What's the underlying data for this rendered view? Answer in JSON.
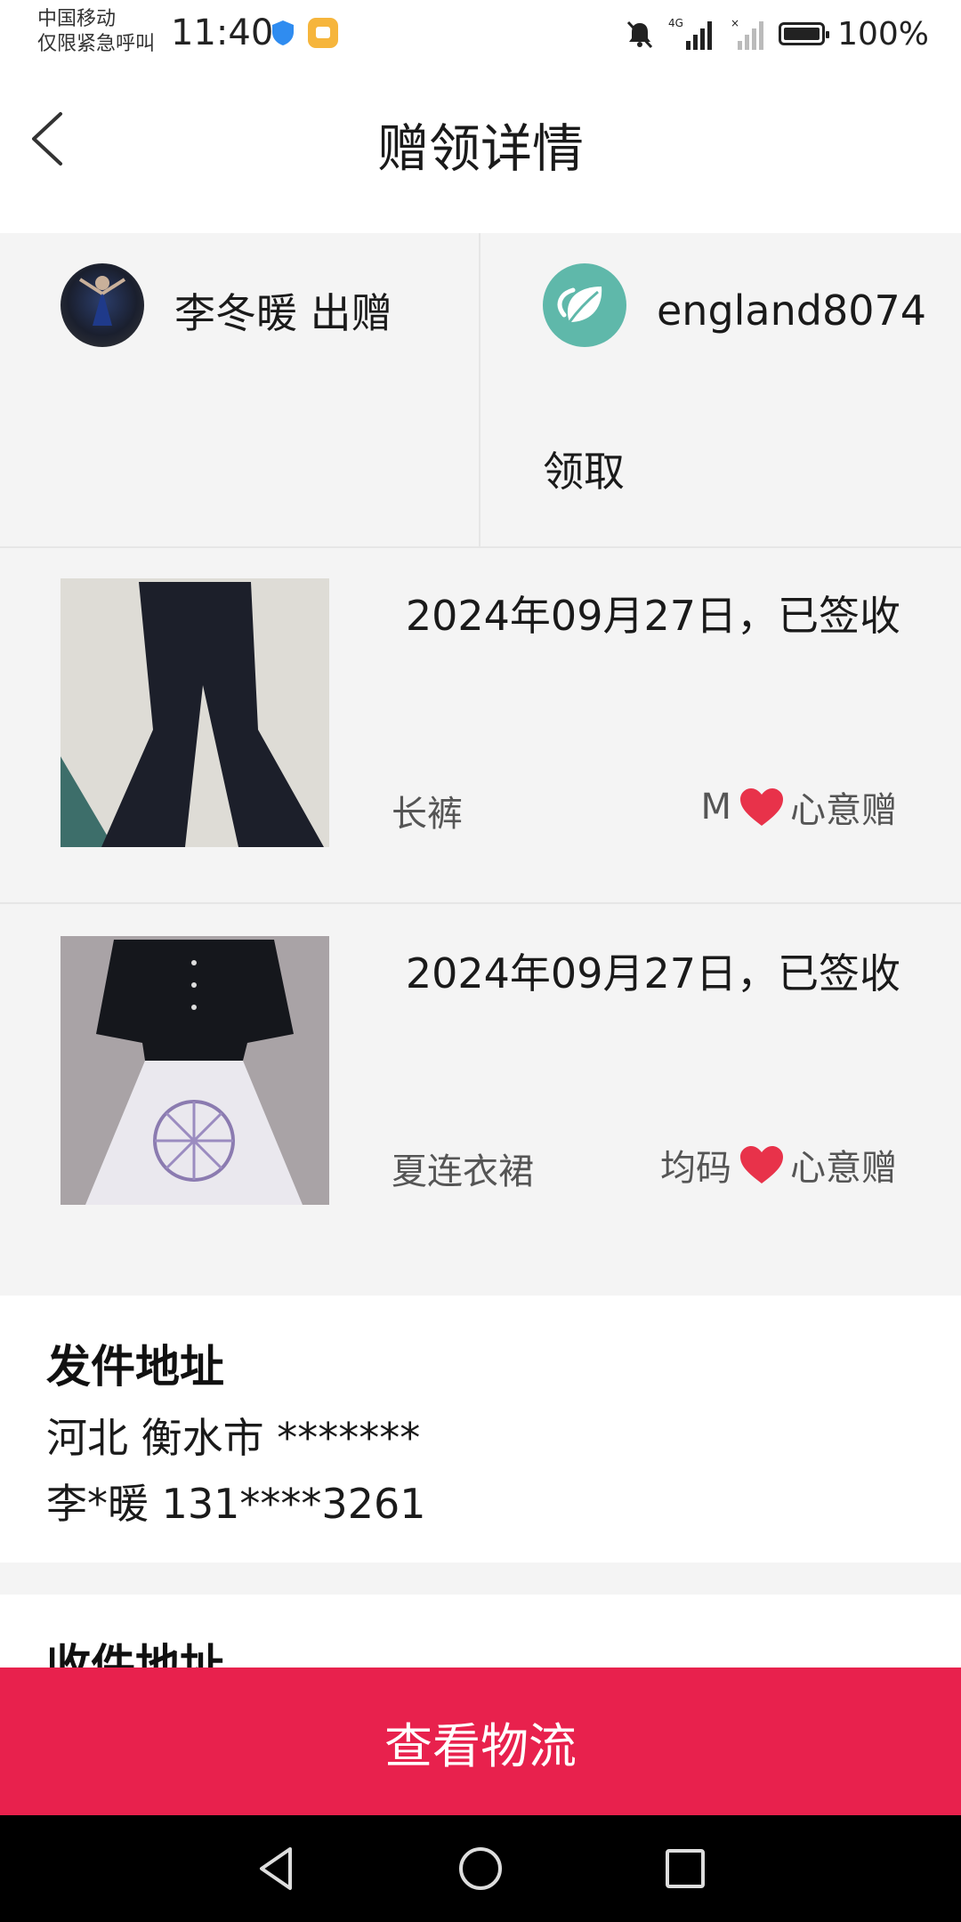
{
  "status_bar": {
    "carrier_line1": "中国移动",
    "carrier_line2": "仅限紧急呼叫",
    "time": "11:40",
    "battery": "100%",
    "network": "4G"
  },
  "header": {
    "title": "赠领详情"
  },
  "users": {
    "giver": {
      "name": "李冬暖 出赠"
    },
    "receiver": {
      "name": "england8074",
      "action": "领取"
    }
  },
  "items": [
    {
      "date_status": "2024年09月27日，已签收",
      "name": "长裤",
      "size": "M",
      "tag": "心意赠"
    },
    {
      "date_status": "2024年09月27日，已签收",
      "name": "夏连衣裙",
      "size": "均码",
      "tag": "心意赠"
    }
  ],
  "sender_address": {
    "title": "发件地址",
    "line1": "河北 衡水市 *******",
    "line2": "李*暖 131****3261"
  },
  "receiver_address": {
    "title": "收件地址"
  },
  "actions": {
    "view_logistics": "查看物流"
  },
  "colors": {
    "accent": "#e8214d",
    "heart": "#e8324a",
    "background_grey": "#f4f4f4"
  }
}
